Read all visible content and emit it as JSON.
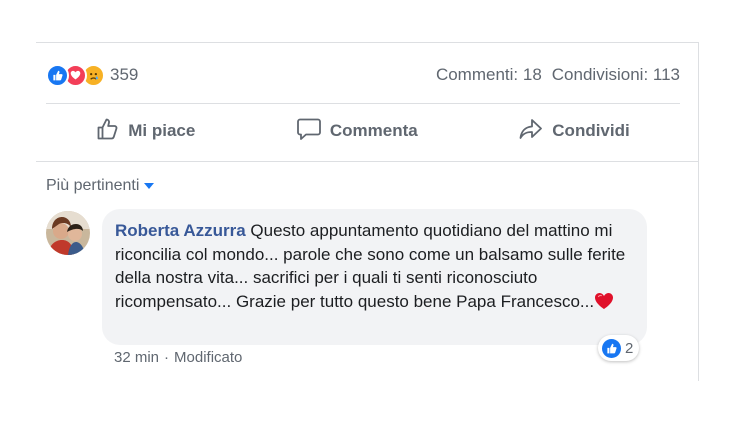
{
  "stats": {
    "reactions": [
      "like-icon",
      "love-icon",
      "sad-icon"
    ],
    "reaction_count": "359",
    "comments": "Commenti: 18",
    "shares": "Condivisioni: 113"
  },
  "actions": {
    "like_label": "Mi piace",
    "comment_label": "Commenta",
    "share_label": "Condividi"
  },
  "sort": {
    "label": "Più pertinenti"
  },
  "comment": {
    "author": "Roberta Azzurra",
    "text": " Questo appuntamento quotidiano del mattino mi riconcilia col mondo... parole che sono come un balsamo sulle ferite della nostra vita... sacrifici per i quali ti senti riconosciuto ricompensato... Grazie per tutto questo bene Papa Francesco...",
    "reaction_count": "2",
    "time": "32 min",
    "separator": "·",
    "edited": "Modificato"
  },
  "colors": {
    "facebook_blue": "#1877f2",
    "author_link": "#385898",
    "love_red": "#f33e58",
    "sad_yellow": "#f7b125",
    "bubble_bg": "#f2f3f5",
    "muted_text": "#606770"
  }
}
